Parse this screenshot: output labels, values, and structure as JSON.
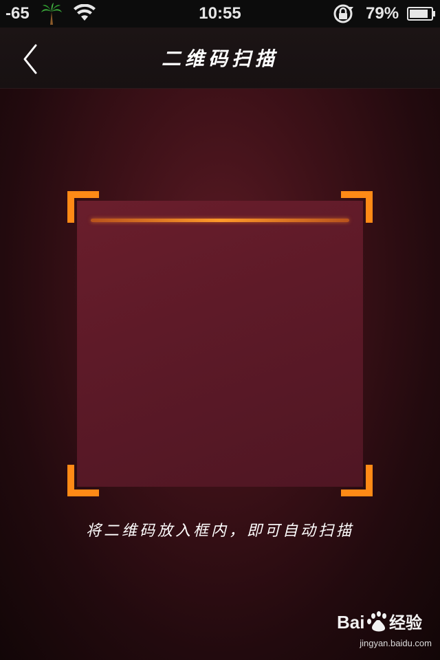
{
  "status_bar": {
    "signal": "-65",
    "time": "10:55",
    "battery_percent": "79%",
    "icons": [
      "palm-tree-icon",
      "wifi-icon",
      "rotation-lock-icon",
      "battery-icon"
    ]
  },
  "nav": {
    "title": "二维码扫描",
    "back_icon": "chevron-left-icon"
  },
  "scanner": {
    "hint": "将二维码放入框内，即可自动扫描",
    "accent_color": "#ff8a16"
  },
  "watermark": {
    "brand": "Bai 经验",
    "url": "jingyan.baidu.com"
  }
}
